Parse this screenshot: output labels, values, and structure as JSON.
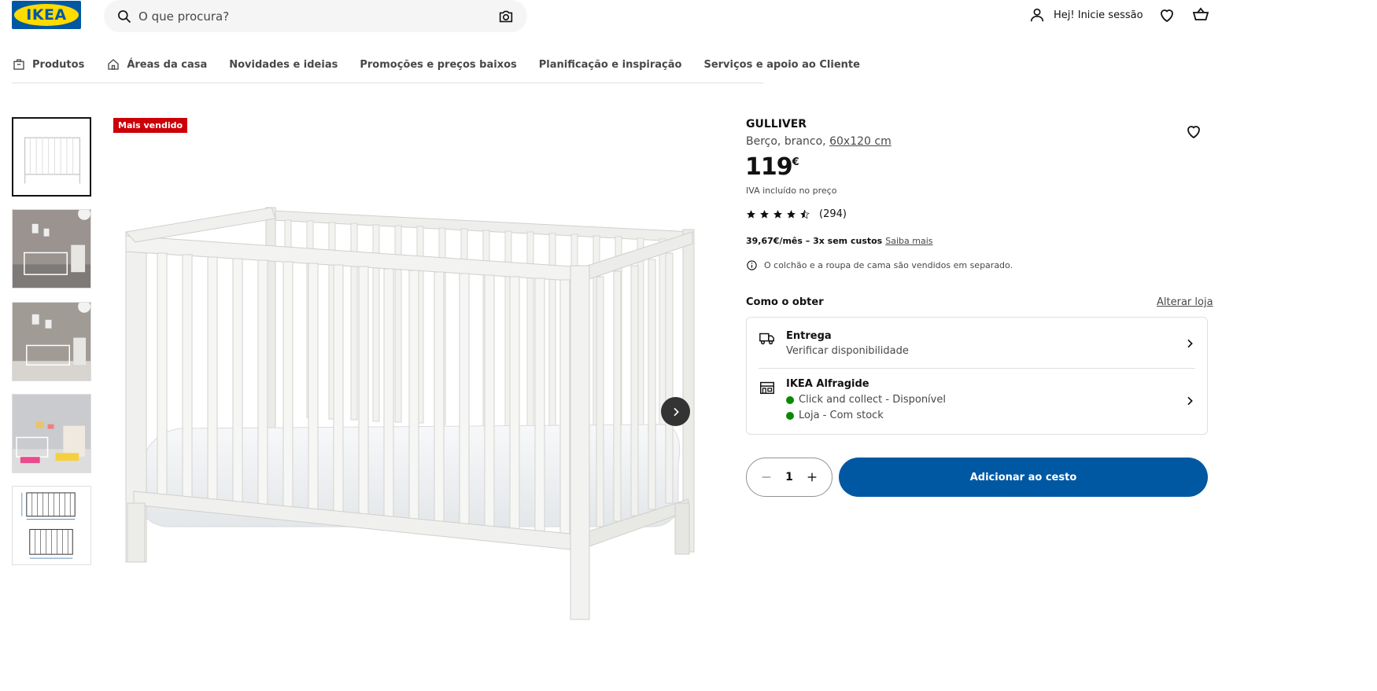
{
  "brand": {
    "logo_text": "IKEA",
    "accent": "#0058a3",
    "yellow": "#ffdb00"
  },
  "search": {
    "placeholder": "O que procura?"
  },
  "header": {
    "login_label": "Hej! Inicie sessão",
    "icons": [
      "user-icon",
      "heart-icon",
      "basket-icon"
    ]
  },
  "nav": {
    "items": [
      {
        "label": "Produtos",
        "icon": "products-icon"
      },
      {
        "label": "Áreas da casa",
        "icon": "home-icon"
      },
      {
        "label": "Novidades e ideias"
      },
      {
        "label": "Promoções e preços baixos"
      },
      {
        "label": "Planificação e inspiração"
      },
      {
        "label": "Serviços e apoio ao Cliente"
      }
    ]
  },
  "gallery": {
    "badge": "Mais vendido",
    "thumbnail_count": 5,
    "active_index": 0
  },
  "product": {
    "name": "GULLIVER",
    "description_prefix": "Berço, branco, ",
    "size_link": "60x120 cm",
    "price_number": "119",
    "price_currency": "€",
    "vat_note": "IVA incluído no preço",
    "rating_value": 4.5,
    "rating_count": "(294)",
    "finance_text": "39,67€/mês – 3x sem custos",
    "finance_link": "Saiba mais",
    "notice": "O colchão e a roupa de cama são vendidos em separado."
  },
  "availability": {
    "heading": "Como o obter",
    "change_store": "Alterar loja",
    "delivery": {
      "title": "Entrega",
      "subtitle": "Verificar disponibilidade"
    },
    "store": {
      "title": "IKEA Alfragide",
      "line1": "Click and collect - Disponível",
      "line2": "Loja - Com stock",
      "status_color": "#0a8a00"
    }
  },
  "purchase": {
    "quantity": "1",
    "add_label": "Adicionar ao cesto"
  }
}
